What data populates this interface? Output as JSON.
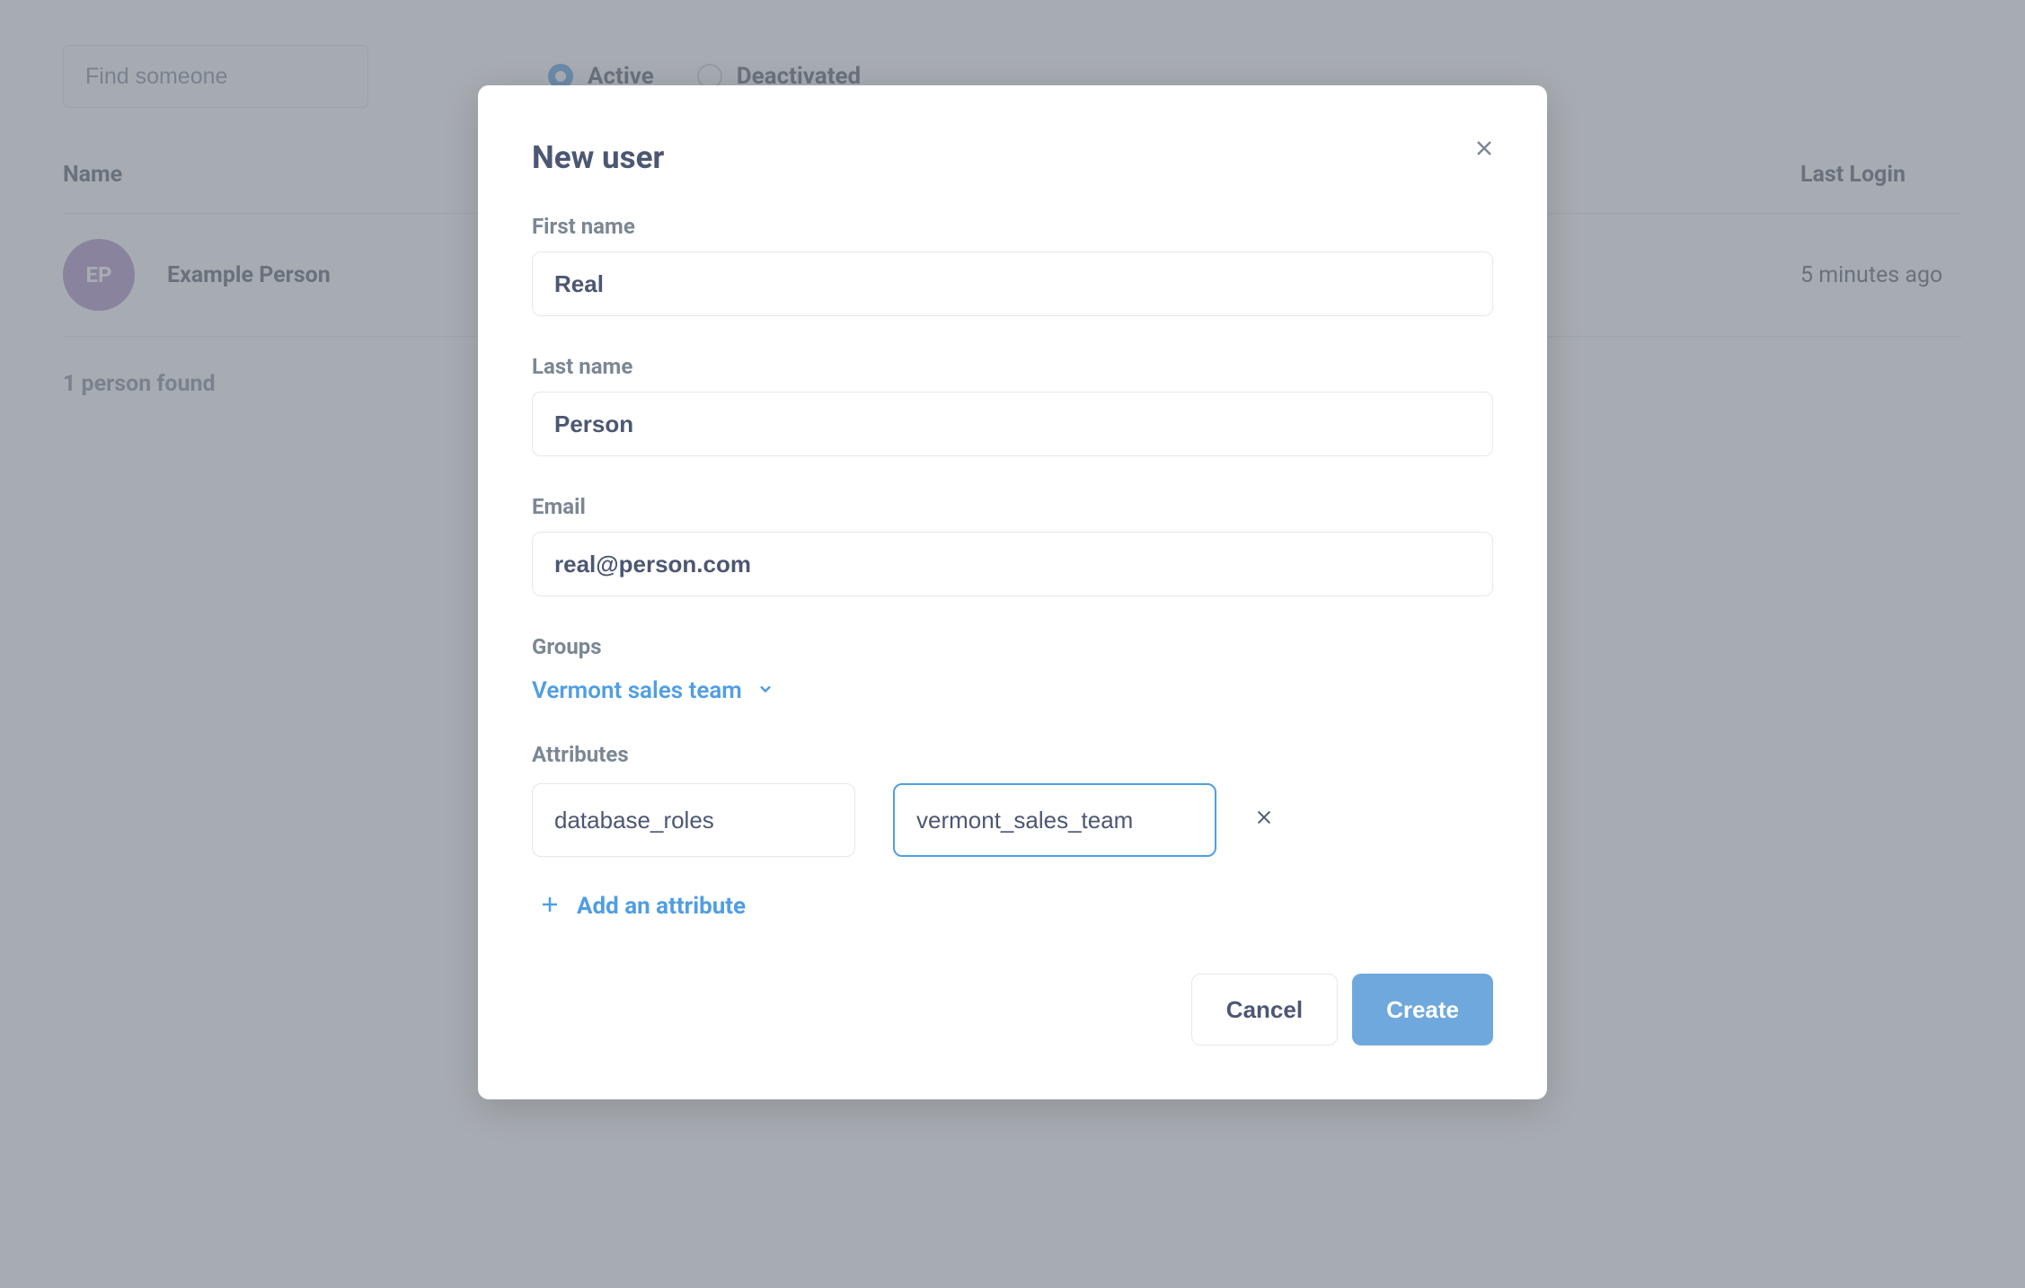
{
  "background": {
    "search_placeholder": "Find someone",
    "radios": {
      "active_label": "Active",
      "deactivated_label": "Deactivated"
    },
    "table": {
      "header_name": "Name",
      "header_last_login": "Last Login",
      "row": {
        "initials": "EP",
        "name": "Example Person",
        "last_login": "5 minutes ago"
      }
    },
    "footer": "1 person found"
  },
  "modal": {
    "title": "New user",
    "fields": {
      "first_name_label": "First name",
      "first_name_value": "Real",
      "last_name_label": "Last name",
      "last_name_value": "Person",
      "email_label": "Email",
      "email_value": "real@person.com",
      "groups_label": "Groups",
      "groups_value": "Vermont sales team",
      "attributes_label": "Attributes",
      "attribute_key": "database_roles",
      "attribute_value": "vermont_sales_team",
      "add_attribute_label": "Add an attribute"
    },
    "buttons": {
      "cancel": "Cancel",
      "create": "Create"
    }
  }
}
